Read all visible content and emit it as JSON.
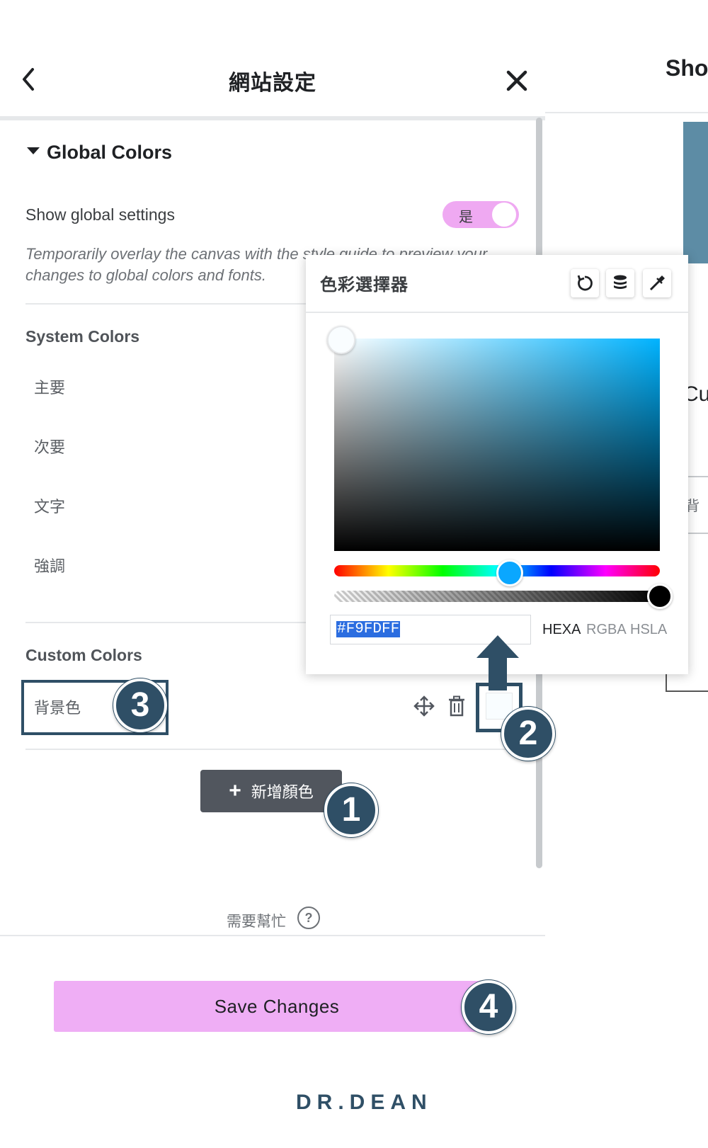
{
  "header": {
    "title": "網站設定",
    "back_icon": "chevron-left-icon",
    "close_icon": "close-icon"
  },
  "global_colors": {
    "section_title": "Global Colors",
    "show_label": "Show global settings",
    "toggle_label": "是",
    "toggle_on": true,
    "hint": "Temporarily overlay the canvas with the style guide to preview your changes to global colors and fonts."
  },
  "system_colors": {
    "title": "System Colors",
    "items": [
      "主要",
      "次要",
      "文字",
      "強調"
    ]
  },
  "custom_colors": {
    "title": "Custom Colors",
    "items": [
      {
        "name": "背景色",
        "color": "#F9FDFF"
      }
    ]
  },
  "add_button": {
    "plus": "+",
    "label": "新增顏色"
  },
  "help": {
    "label": "需要幫忙",
    "icon_glyph": "?"
  },
  "save_button": {
    "label": "Save Changes"
  },
  "preview": {
    "title": "Sho",
    "c": "Cu",
    "box_text": "背"
  },
  "picker": {
    "title": "色彩選擇器",
    "tools": [
      "reset-icon",
      "database-icon",
      "eyedropper-icon"
    ],
    "hex_value": "#F9FDFF",
    "formats": [
      "HEXA",
      "RGBA",
      "HSLA"
    ],
    "active_format": "HEXA",
    "hue_position": 0.54,
    "alpha": 1.0
  },
  "callouts": [
    "1",
    "2",
    "3",
    "4"
  ],
  "logo": "DR.DEAN",
  "colors": {
    "accent": "#EFAEF5",
    "callout": "#2F4F66",
    "button_dark": "#51565E"
  }
}
